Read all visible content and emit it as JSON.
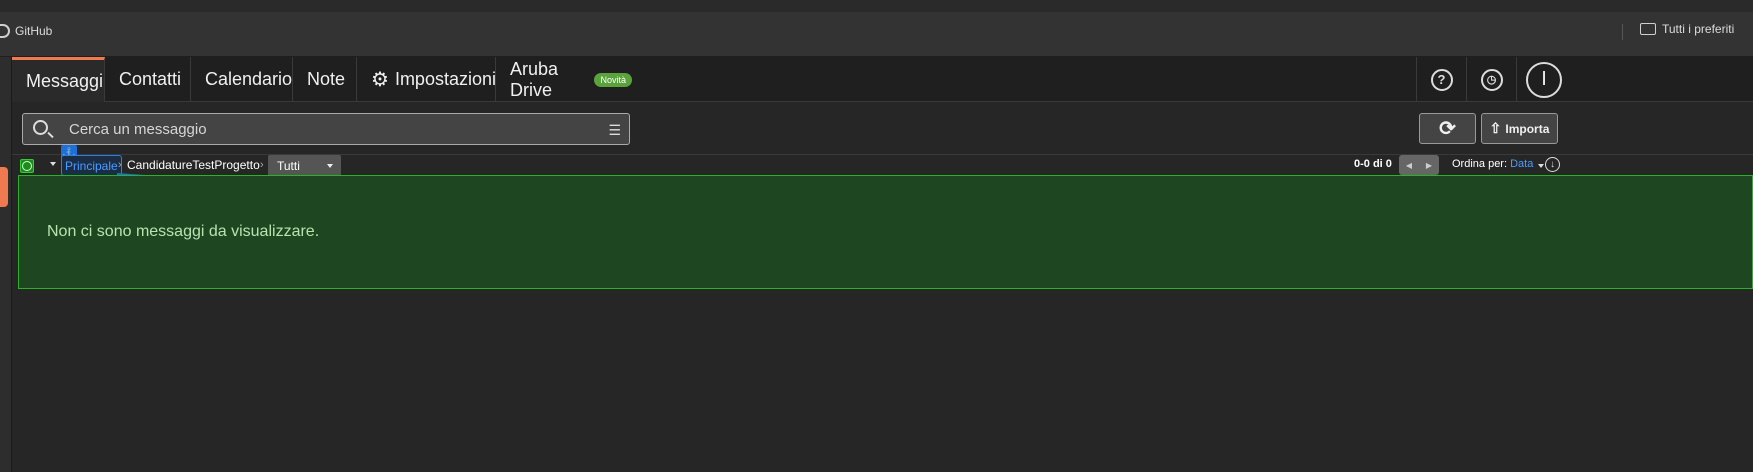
{
  "bookmarks": {
    "github_label": "GitHub",
    "favorites_label": "Tutti i preferiti"
  },
  "nav": {
    "tabs": [
      {
        "label": "Messaggi"
      },
      {
        "label": "Contatti"
      },
      {
        "label": "Calendario"
      },
      {
        "label": "Note"
      },
      {
        "label": "Impostazioni"
      },
      {
        "label": "Aruba Drive"
      }
    ],
    "drive_badge": "Novità",
    "help_icon": "?",
    "avatar_initial": "I"
  },
  "toolbar": {
    "search_placeholder": "Cerca un messaggio",
    "import_label": "Importa"
  },
  "breadcrumb": {
    "root": "Principale",
    "folder": "CandidatureTestProgetto",
    "filter_value": "Tutti"
  },
  "list": {
    "counter": "0-0 di 0",
    "sort_label": "Ordina per:",
    "sort_value": "Data",
    "empty_message": "Non ci sono messaggi da visualizzare."
  },
  "colors": {
    "accent": "#f07a4f",
    "link": "#4a9bff",
    "empty_bg": "#1e4620",
    "badge": "#5aa33c"
  }
}
